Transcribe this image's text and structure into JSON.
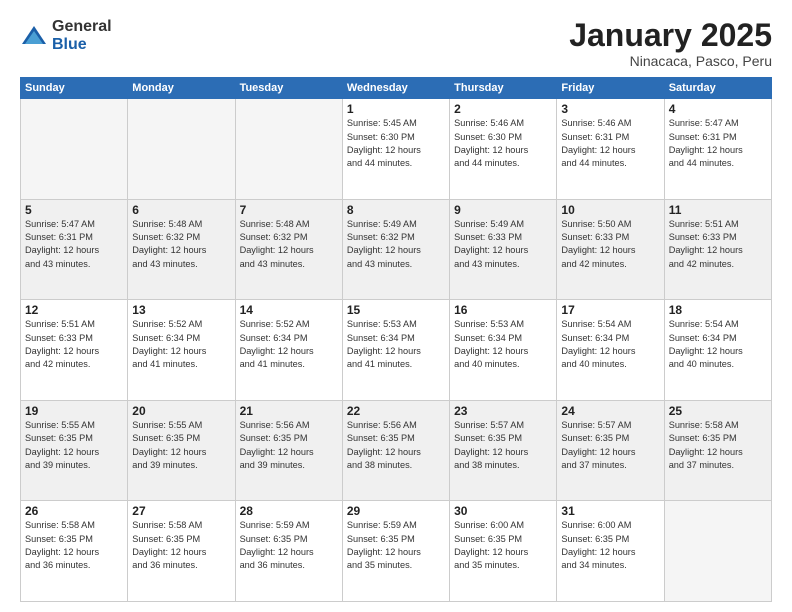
{
  "logo": {
    "general": "General",
    "blue": "Blue"
  },
  "title": "January 2025",
  "subtitle": "Ninacaca, Pasco, Peru",
  "days_of_week": [
    "Sunday",
    "Monday",
    "Tuesday",
    "Wednesday",
    "Thursday",
    "Friday",
    "Saturday"
  ],
  "weeks": [
    [
      {
        "num": "",
        "info": ""
      },
      {
        "num": "",
        "info": ""
      },
      {
        "num": "",
        "info": ""
      },
      {
        "num": "1",
        "info": "Sunrise: 5:45 AM\nSunset: 6:30 PM\nDaylight: 12 hours\nand 44 minutes."
      },
      {
        "num": "2",
        "info": "Sunrise: 5:46 AM\nSunset: 6:30 PM\nDaylight: 12 hours\nand 44 minutes."
      },
      {
        "num": "3",
        "info": "Sunrise: 5:46 AM\nSunset: 6:31 PM\nDaylight: 12 hours\nand 44 minutes."
      },
      {
        "num": "4",
        "info": "Sunrise: 5:47 AM\nSunset: 6:31 PM\nDaylight: 12 hours\nand 44 minutes."
      }
    ],
    [
      {
        "num": "5",
        "info": "Sunrise: 5:47 AM\nSunset: 6:31 PM\nDaylight: 12 hours\nand 43 minutes."
      },
      {
        "num": "6",
        "info": "Sunrise: 5:48 AM\nSunset: 6:32 PM\nDaylight: 12 hours\nand 43 minutes."
      },
      {
        "num": "7",
        "info": "Sunrise: 5:48 AM\nSunset: 6:32 PM\nDaylight: 12 hours\nand 43 minutes."
      },
      {
        "num": "8",
        "info": "Sunrise: 5:49 AM\nSunset: 6:32 PM\nDaylight: 12 hours\nand 43 minutes."
      },
      {
        "num": "9",
        "info": "Sunrise: 5:49 AM\nSunset: 6:33 PM\nDaylight: 12 hours\nand 43 minutes."
      },
      {
        "num": "10",
        "info": "Sunrise: 5:50 AM\nSunset: 6:33 PM\nDaylight: 12 hours\nand 42 minutes."
      },
      {
        "num": "11",
        "info": "Sunrise: 5:51 AM\nSunset: 6:33 PM\nDaylight: 12 hours\nand 42 minutes."
      }
    ],
    [
      {
        "num": "12",
        "info": "Sunrise: 5:51 AM\nSunset: 6:33 PM\nDaylight: 12 hours\nand 42 minutes."
      },
      {
        "num": "13",
        "info": "Sunrise: 5:52 AM\nSunset: 6:34 PM\nDaylight: 12 hours\nand 41 minutes."
      },
      {
        "num": "14",
        "info": "Sunrise: 5:52 AM\nSunset: 6:34 PM\nDaylight: 12 hours\nand 41 minutes."
      },
      {
        "num": "15",
        "info": "Sunrise: 5:53 AM\nSunset: 6:34 PM\nDaylight: 12 hours\nand 41 minutes."
      },
      {
        "num": "16",
        "info": "Sunrise: 5:53 AM\nSunset: 6:34 PM\nDaylight: 12 hours\nand 40 minutes."
      },
      {
        "num": "17",
        "info": "Sunrise: 5:54 AM\nSunset: 6:34 PM\nDaylight: 12 hours\nand 40 minutes."
      },
      {
        "num": "18",
        "info": "Sunrise: 5:54 AM\nSunset: 6:34 PM\nDaylight: 12 hours\nand 40 minutes."
      }
    ],
    [
      {
        "num": "19",
        "info": "Sunrise: 5:55 AM\nSunset: 6:35 PM\nDaylight: 12 hours\nand 39 minutes."
      },
      {
        "num": "20",
        "info": "Sunrise: 5:55 AM\nSunset: 6:35 PM\nDaylight: 12 hours\nand 39 minutes."
      },
      {
        "num": "21",
        "info": "Sunrise: 5:56 AM\nSunset: 6:35 PM\nDaylight: 12 hours\nand 39 minutes."
      },
      {
        "num": "22",
        "info": "Sunrise: 5:56 AM\nSunset: 6:35 PM\nDaylight: 12 hours\nand 38 minutes."
      },
      {
        "num": "23",
        "info": "Sunrise: 5:57 AM\nSunset: 6:35 PM\nDaylight: 12 hours\nand 38 minutes."
      },
      {
        "num": "24",
        "info": "Sunrise: 5:57 AM\nSunset: 6:35 PM\nDaylight: 12 hours\nand 37 minutes."
      },
      {
        "num": "25",
        "info": "Sunrise: 5:58 AM\nSunset: 6:35 PM\nDaylight: 12 hours\nand 37 minutes."
      }
    ],
    [
      {
        "num": "26",
        "info": "Sunrise: 5:58 AM\nSunset: 6:35 PM\nDaylight: 12 hours\nand 36 minutes."
      },
      {
        "num": "27",
        "info": "Sunrise: 5:58 AM\nSunset: 6:35 PM\nDaylight: 12 hours\nand 36 minutes."
      },
      {
        "num": "28",
        "info": "Sunrise: 5:59 AM\nSunset: 6:35 PM\nDaylight: 12 hours\nand 36 minutes."
      },
      {
        "num": "29",
        "info": "Sunrise: 5:59 AM\nSunset: 6:35 PM\nDaylight: 12 hours\nand 35 minutes."
      },
      {
        "num": "30",
        "info": "Sunrise: 6:00 AM\nSunset: 6:35 PM\nDaylight: 12 hours\nand 35 minutes."
      },
      {
        "num": "31",
        "info": "Sunrise: 6:00 AM\nSunset: 6:35 PM\nDaylight: 12 hours\nand 34 minutes."
      },
      {
        "num": "",
        "info": ""
      }
    ]
  ]
}
